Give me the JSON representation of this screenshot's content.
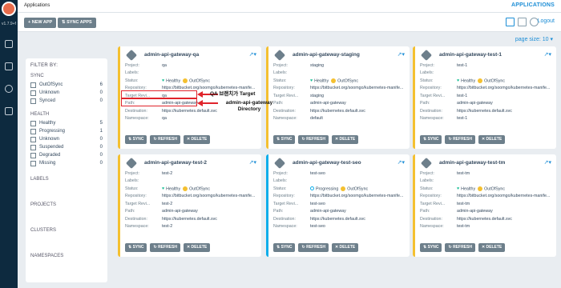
{
  "app": {
    "version": "v1.7.9+f",
    "breadcrumb": "Applications",
    "title": "APPLICATIONS"
  },
  "toolbar": {
    "new_app": "+ NEW APP",
    "sync_apps": "⇅ SYNC APPS",
    "logout": "Logout",
    "page_size": "page size: 10 ▾"
  },
  "filter": {
    "heading": "FILTER BY:",
    "sync_title": "SYNC",
    "sync": [
      {
        "label": "OutOfSync",
        "count": "6"
      },
      {
        "label": "Unknown",
        "count": "0"
      },
      {
        "label": "Synced",
        "count": "0"
      }
    ],
    "health_title": "HEALTH",
    "health": [
      {
        "label": "Healthy",
        "count": "5"
      },
      {
        "label": "Progressing",
        "count": "1"
      },
      {
        "label": "Unknown",
        "count": "0"
      },
      {
        "label": "Suspended",
        "count": "0"
      },
      {
        "label": "Degraded",
        "count": "0"
      },
      {
        "label": "Missing",
        "count": "0"
      }
    ],
    "labels": "LABELS",
    "projects": "PROJECTS",
    "clusters": "CLUSTERS",
    "namespaces": "NAMESPACES"
  },
  "field_labels": {
    "project": "Project:",
    "labels": "Labels:",
    "status": "Status:",
    "repository": "Repository:",
    "target": "Target Revi...",
    "path": "Path:",
    "destination": "Destination:",
    "namespace": "Namespace:"
  },
  "status": {
    "healthy": "Healthy",
    "progressing": "Progressing",
    "outofsync": "OutOfSync"
  },
  "buttons": {
    "sync": "⇅ SYNC",
    "refresh": "↻ REFRESH",
    "delete": "✕ DELETE"
  },
  "cards": [
    {
      "name": "admin-api-gateway-qa",
      "project": "qa",
      "labels": "",
      "repo": "https://bitbucket.org/soomgo/kubernetes-manife...",
      "target": "qa",
      "path": "admin-api-gateway",
      "dest": "https://kubernetes.default.svc",
      "ns": "qa"
    },
    {
      "name": "admin-api-gateway-staging",
      "project": "staging",
      "labels": "",
      "repo": "https://bitbucket.org/soomgo/kubernetes-manife...",
      "target": "staging",
      "path": "admin-api-gateway",
      "dest": "https://kubernetes.default.svc",
      "ns": "default"
    },
    {
      "name": "admin-api-gateway-test-1",
      "project": "test-1",
      "labels": "",
      "repo": "https://bitbucket.org/soomgo/kubernetes-manife...",
      "target": "test-1",
      "path": "admin-api-gateway",
      "dest": "https://kubernetes.default.svc",
      "ns": "test-1"
    },
    {
      "name": "admin-api-gateway-test-2",
      "project": "test-2",
      "labels": "",
      "repo": "https://bitbucket.org/soomgo/kubernetes-manife...",
      "target": "test-2",
      "path": "admin-api-gateway",
      "dest": "https://kubernetes.default.svc",
      "ns": "test-2"
    },
    {
      "name": "admin-api-gateway-test-seo",
      "project": "test-seo",
      "labels": "",
      "repo": "https://bitbucket.org/soomgo/kubernetes-manife...",
      "target": "test-seo",
      "path": "admin-api-gateway",
      "dest": "https://kubernetes.default.svc",
      "ns": "test-seo"
    },
    {
      "name": "admin-api-gateway-test-tm",
      "project": "test-tm",
      "labels": "",
      "repo": "https://bitbucket.org/soomgo/kubernetes-manife...",
      "target": "test-tm",
      "path": "admin-api-gateway",
      "dest": "https://kubernetes.default.svc",
      "ns": "test-tm"
    }
  ],
  "annotations": {
    "target": "QA 브랜치가 Target",
    "path": "admin-api-gateway Directory"
  }
}
